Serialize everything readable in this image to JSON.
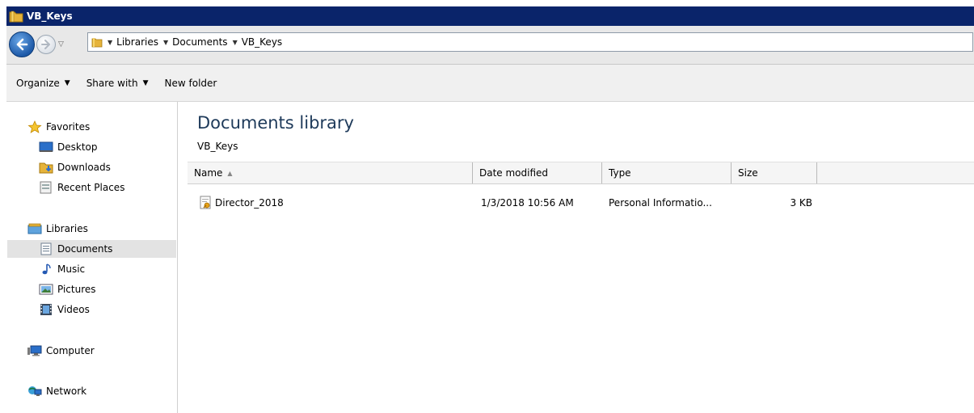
{
  "window": {
    "title": "VB_Keys"
  },
  "breadcrumb": [
    "Libraries",
    "Documents",
    "VB_Keys"
  ],
  "toolbar": {
    "organize": "Organize",
    "share_with": "Share with",
    "new_folder": "New folder"
  },
  "sidebar": {
    "favorites": "Favorites",
    "desktop": "Desktop",
    "downloads": "Downloads",
    "recent_places": "Recent Places",
    "libraries": "Libraries",
    "documents": "Documents",
    "music": "Music",
    "pictures": "Pictures",
    "videos": "Videos",
    "computer": "Computer",
    "network": "Network"
  },
  "main": {
    "library_title": "Documents library",
    "library_subtitle": "VB_Keys",
    "columns": {
      "name": "Name",
      "date": "Date modified",
      "type": "Type",
      "size": "Size"
    },
    "files": [
      {
        "name": "Director_2018",
        "date": "1/3/2018 10:56 AM",
        "type": "Personal Informatio...",
        "size": "3 KB"
      }
    ]
  },
  "colors": {
    "titlebar": "#0a246a",
    "selection": "#e3e3e3",
    "accent": "#1e5aa8"
  }
}
